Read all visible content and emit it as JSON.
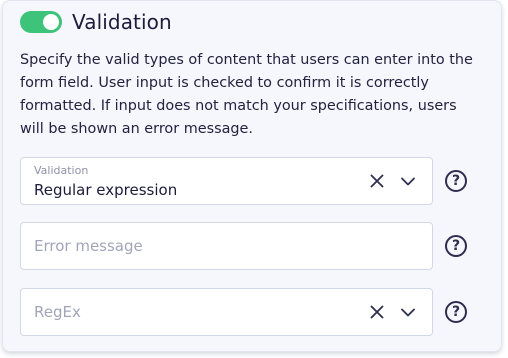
{
  "section": {
    "title": "Validation",
    "toggle_on": true,
    "toggle_color": "#3ec47a",
    "description": "Specify the valid types of content that users can enter into the form field. User input is checked to confirm it is correctly formatted. If input does not match your specifications, users will be shown an error message."
  },
  "fields": {
    "validation": {
      "label": "Validation",
      "value": "Regular expression"
    },
    "error_message": {
      "placeholder": "Error message"
    },
    "regex": {
      "placeholder": "RegEx"
    }
  },
  "help_icon_glyph": "?",
  "icons": {
    "clear": "close-icon",
    "dropdown": "chevron-down-icon",
    "help": "question-circle-icon"
  }
}
